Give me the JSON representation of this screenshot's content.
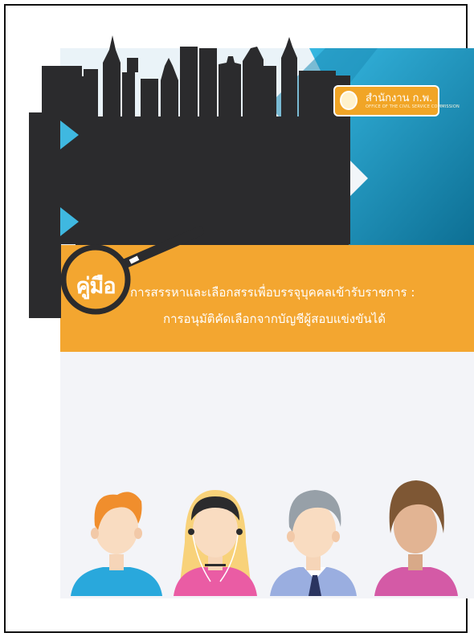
{
  "cover": {
    "logo_name": "สำนักงาน ก.พ.",
    "logo_subtitle": "OFFICE OF THE CIVIL SERVICE COMMISSION",
    "manual_word": "คู่มือ",
    "title_line1": "การสรรหาและเลือกสรรเพื่อบรรจุบุคคลเข้ารับราชการ :",
    "title_line2": "การอนุมัติคัดเลือกจากบัญชีผู้สอบแข่งขันได้"
  },
  "colors": {
    "orange": "#f3a630",
    "city_dark": "#2b2b2d",
    "teal": "#1f93bb",
    "light_bg": "#f3f4f8"
  },
  "icons": [
    "seal-icon",
    "magnifier-icon",
    "person-icon"
  ]
}
